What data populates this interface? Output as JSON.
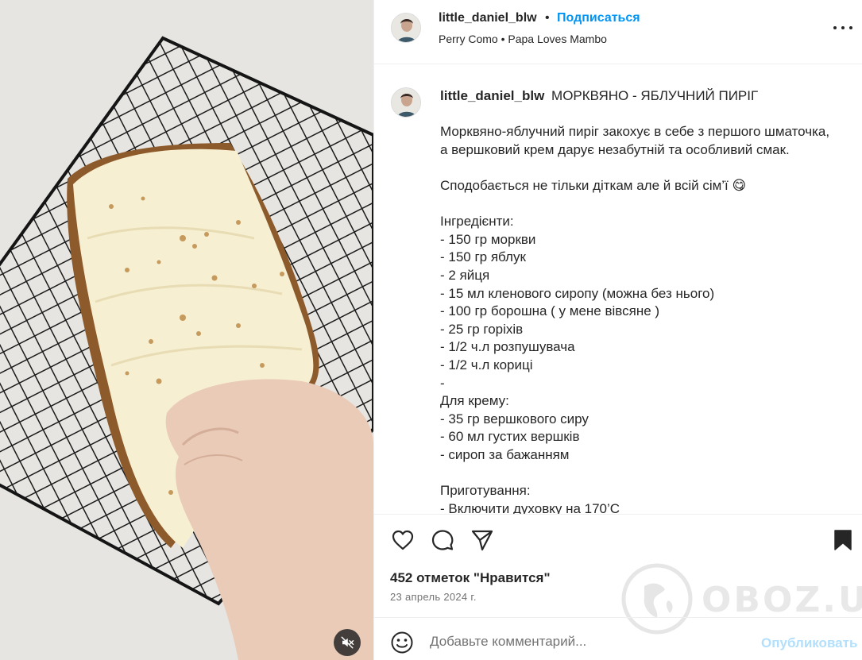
{
  "post": {
    "username": "little_daniel_blw",
    "dot": "•",
    "follow_label": "Подписаться",
    "music_artist": "Perry Como",
    "music_sep": "•",
    "music_title": "Papa Loves Mambo"
  },
  "caption": {
    "username": "little_daniel_blw",
    "title": "МОРКВЯНО - ЯБЛУЧНИЙ ПИРІГ",
    "text": "Морквяно-яблучний пиріг закохує в себе з першого шматочка,\nа вершковий крем дарує незабутній та особливий смак.\n\nСподобається не тільки діткам але й всій сім’ї 😋\n\nІнгредієнти:\n- 150 гр моркви\n- 150 гр яблук\n- 2 яйця\n- 15 мл кленового сиропу (можна без нього)\n- 100 гр борошна ( у мене вівсяне )\n- 25 гр горіхів\n- 1/2 ч.л розпушувача\n- 1/2 ч.л кориці\n-\nДля крему:\n- 35 гр вершкового сиру\n- 60 мл густих вершків\n- сироп за бажанням\n\nПриготування:\n- Включити духовку на 170’С"
  },
  "engagement": {
    "likes_text": "452 отметок \"Нравится\"",
    "date": "23 апрель 2024 г."
  },
  "comment": {
    "placeholder": "Добавьте комментарий...",
    "publish_label": "Опубликовать"
  },
  "watermark": {
    "text": "OBOZ.UA"
  },
  "icons": {
    "like": "heart-icon",
    "comment": "comment-bubble-icon",
    "share": "paper-plane-icon",
    "save": "bookmark-filled-icon",
    "emoji": "smiley-icon",
    "mute": "speaker-muted-icon",
    "more": "more-dots-icon"
  },
  "colors": {
    "accent": "#0095f6",
    "publish_disabled": "#b2dffc",
    "text": "#262626",
    "secondary_text": "#737373"
  }
}
